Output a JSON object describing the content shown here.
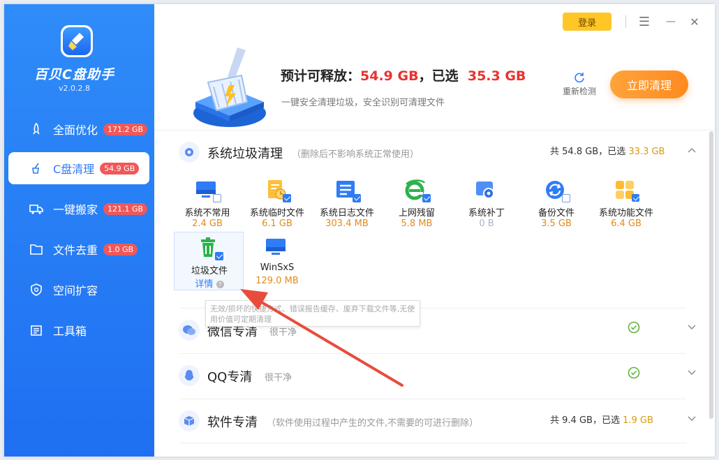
{
  "app": {
    "name": "百贝C盘助手",
    "version": "v2.0.2.8"
  },
  "sidebar": {
    "items": [
      {
        "label": "全面优化",
        "badge": "171.2 GB"
      },
      {
        "label": "C盘清理",
        "badge": "54.9 GB"
      },
      {
        "label": "一键搬家",
        "badge": "121.1 GB"
      },
      {
        "label": "文件去重",
        "badge": "1.0 GB"
      },
      {
        "label": "空间扩容",
        "badge": ""
      },
      {
        "label": "工具箱",
        "badge": ""
      }
    ]
  },
  "topbar": {
    "login_label": "登录",
    "menu_glyph": "☰",
    "min_glyph": "—",
    "close_glyph": "✕"
  },
  "header": {
    "summary_prefix": "预计可释放：",
    "releasable": "54.9 GB",
    "selected_prefix": "，已选",
    "selected": "35.3 GB",
    "subtitle": "一键安全清理垃圾，安全识别可清理文件",
    "rescan_label": "重新检测",
    "clean_label": "立即清理"
  },
  "sections": {
    "system": {
      "title": "系统垃圾清理",
      "desc": "（删除后不影响系统正常使用）",
      "stats_prefix": "共",
      "total": "54.8 GB",
      "stats_mid": "，已选",
      "selected": "33.3 GB",
      "items": [
        {
          "label": "系统不常用",
          "size": "2.4 GB"
        },
        {
          "label": "系统临时文件",
          "size": "6.1 GB"
        },
        {
          "label": "系统日志文件",
          "size": "303.4 MB"
        },
        {
          "label": "上网残留",
          "size": "5.8 MB"
        },
        {
          "label": "系统补丁",
          "size": "0 B"
        },
        {
          "label": "备份文件",
          "size": "3.5 GB"
        },
        {
          "label": "系统功能文件",
          "size": "6.4 GB"
        },
        {
          "label": "垃圾文件",
          "size": "详情"
        },
        {
          "label": "WinSxS",
          "size": "129.0 MB"
        }
      ],
      "tooltip": "无效/损坏的快捷方式、错误报告缓存、废弃下载文件等,无使用价值可定期清理"
    },
    "wechat": {
      "title": "微信专清",
      "status": "很干净"
    },
    "qq": {
      "title": "QQ专清",
      "status": "很干净"
    },
    "software": {
      "title": "软件专清",
      "desc": "（软件使用过程中产生的文件,不需要的可进行删除）",
      "stats_prefix": "共",
      "total": "9.4 GB",
      "stats_mid": "，已选",
      "selected": "1.9 GB"
    }
  },
  "colors": {
    "accent": "#2f7cf6",
    "orange": "#ff8a1f",
    "red": "#e8322f",
    "gold": "#d89b0d"
  }
}
